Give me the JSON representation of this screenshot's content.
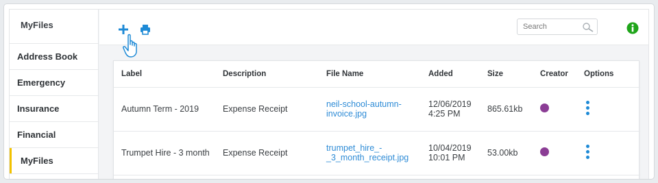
{
  "sidebar": {
    "title": "MyFiles",
    "items": [
      {
        "label": "Address Book"
      },
      {
        "label": "Emergency"
      },
      {
        "label": "Insurance"
      },
      {
        "label": "Financial"
      },
      {
        "label": "MyFiles"
      }
    ],
    "active_index": 4,
    "active_color": "#f2c200"
  },
  "toolbar": {
    "add_icon": "plus-icon",
    "print_icon": "printer-icon",
    "search": {
      "placeholder": "Search",
      "value": ""
    },
    "info_icon": "info-icon"
  },
  "table": {
    "columns": [
      "Label",
      "Description",
      "File Name",
      "Added",
      "Size",
      "Creator",
      "Options"
    ],
    "rows": [
      {
        "label": "Autumn Term - 2019",
        "description": "Expense Receipt",
        "file_name": "neil-school-autumn-invoice.jpg",
        "added_date": "12/06/2019",
        "added_time": "4:25 PM",
        "size": "865.61kb",
        "creator_color": "#8b3d95"
      },
      {
        "label": "Trumpet Hire - 3 month",
        "description": "Expense Receipt",
        "file_name": "trumpet_hire_-_3_month_receipt.jpg",
        "added_date": "10/04/2019",
        "added_time": "10:01 PM",
        "size": "53.00kb",
        "creator_color": "#8b3d95"
      }
    ]
  },
  "colors": {
    "accent": "#1e8ad6",
    "link": "#2d8bd6",
    "info_green": "#1fa51a"
  }
}
